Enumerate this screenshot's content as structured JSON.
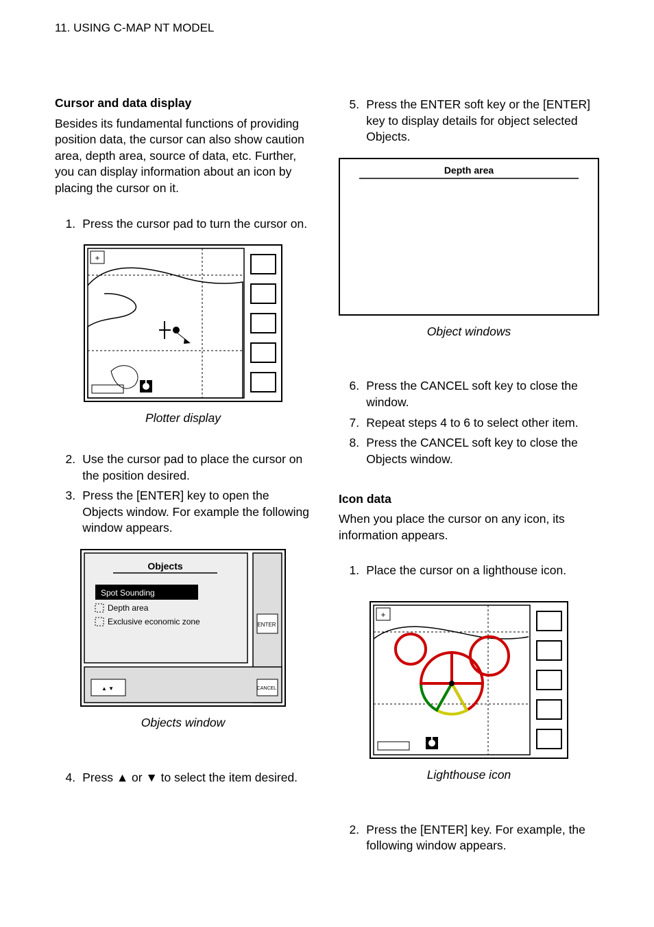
{
  "header": {
    "chapter": "11. USING C-MAP NT MODEL"
  },
  "left": {
    "heading": "Cursor and data display",
    "intro": "Besides its fundamental functions of providing position data, the cursor can also show caution area, depth area, source of data, etc. Further, you can display information about an icon by placing the cursor on it.",
    "steps_a": [
      "Press the cursor pad to turn the cursor on."
    ],
    "fig1_caption": "Plotter display",
    "steps_b": [
      "Use the cursor pad to place the cursor on the position desired.",
      "Press the [ENTER] key to open the Objects window. For example the following window appears."
    ],
    "fig2": {
      "title": "Objects",
      "items": [
        "Spot Sounding",
        "Depth area",
        "Exclusive economic zone"
      ],
      "btn_enter": "ENTER",
      "btn_cancel": "CANCEL",
      "caption": "Objects window"
    },
    "step4": "Press ▲ or ▼ to select the item desired."
  },
  "right": {
    "step5": "Press the ENTER soft key or the [ENTER] key to display details for object selected Objects.",
    "detailbox": {
      "title": "Depth area",
      "caption": "Object windows"
    },
    "steps_c": [
      "Press the CANCEL soft key to close the window.",
      "Repeat steps 4 to 6 to select other item.",
      "Press the CANCEL soft key to close the Objects window."
    ],
    "heading2": "Icon data",
    "intro2": "When you place the cursor on any icon, its information appears.",
    "steps_d": [
      "Place the cursor on a lighthouse icon."
    ],
    "fig3_caption": "Lighthouse icon",
    "step_e": "Press the [ENTER] key. For example, the following window appears."
  }
}
